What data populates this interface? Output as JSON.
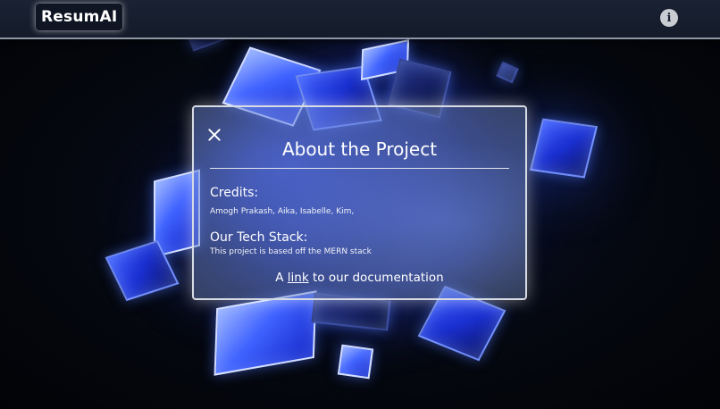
{
  "header": {
    "brand": "ResumAI",
    "info_icon": "info-icon"
  },
  "modal": {
    "title": "About the Project",
    "close_icon": "close-icon",
    "credits_heading": "Credits:",
    "credits_text": "Amogh Prakash, Aika, Isabelle, Kim,",
    "stack_heading": "Our Tech Stack:",
    "stack_text": "This project is based off the MERN stack",
    "doc_prefix": "A",
    "doc_link": "link",
    "doc_suffix": "to our documentation"
  },
  "colors": {
    "header_bg": "#141b2a",
    "accent_blue": "#2a45ff",
    "modal_border": "#d7dbe3"
  }
}
